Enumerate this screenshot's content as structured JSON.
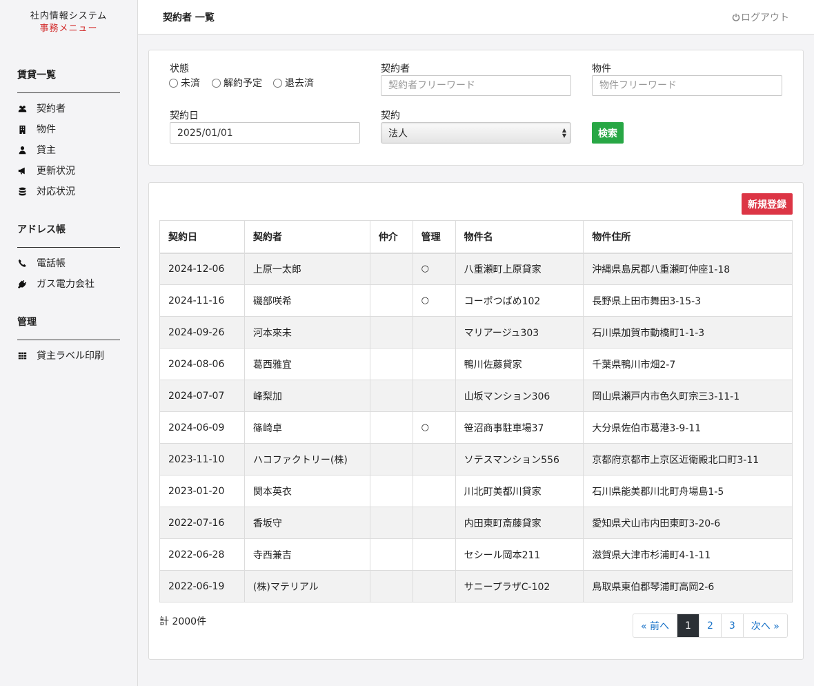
{
  "sidebar": {
    "brand_line1": "社内情報システム",
    "brand_line2": "事務メニュー",
    "sections": [
      {
        "title": "賃貸一覧",
        "items": [
          {
            "label": "契約者",
            "icon": "users-icon"
          },
          {
            "label": "物件",
            "icon": "building-icon"
          },
          {
            "label": "貸主",
            "icon": "user-icon"
          },
          {
            "label": "更新状況",
            "icon": "megaphone-icon"
          },
          {
            "label": "対応状況",
            "icon": "database-icon"
          }
        ]
      },
      {
        "title": "アドレス帳",
        "items": [
          {
            "label": "電話帳",
            "icon": "phone-icon"
          },
          {
            "label": "ガス電力会社",
            "icon": "plug-icon"
          }
        ]
      },
      {
        "title": "管理",
        "items": [
          {
            "label": "貸主ラベル印刷",
            "icon": "grid-icon"
          }
        ]
      }
    ]
  },
  "header": {
    "title": "契約者 一覧",
    "logout": "ログアウト"
  },
  "search": {
    "status_label": "状態",
    "status_options": [
      "未済",
      "解約予定",
      "退去済"
    ],
    "contractor_label": "契約者",
    "contractor_placeholder": "契約者フリーワード",
    "property_label": "物件",
    "property_placeholder": "物件フリーワード",
    "date_label": "契約日",
    "date_value": "2025/01/01",
    "contract_label": "契約",
    "contract_value": "法人",
    "search_button": "検索"
  },
  "list": {
    "new_button": "新規登録",
    "columns": [
      "契約日",
      "契約者",
      "仲介",
      "管理",
      "物件名",
      "物件住所"
    ],
    "rows": [
      [
        "2024-12-06",
        "上原一太郎",
        "",
        "○",
        "八重瀬町上原貸家",
        "沖縄県島尻郡八重瀬町仲座1-18"
      ],
      [
        "2024-11-16",
        "磯部咲希",
        "",
        "○",
        "コーポつばめ102",
        "長野県上田市舞田3-15-3"
      ],
      [
        "2024-09-26",
        "河本來未",
        "",
        "",
        "マリアージュ303",
        "石川県加賀市動橋町1-1-3"
      ],
      [
        "2024-08-06",
        "葛西雅宜",
        "",
        "",
        "鴨川佐藤貸家",
        "千葉県鴨川市畑2-7"
      ],
      [
        "2024-07-07",
        "峰梨加",
        "",
        "",
        "山坂マンション306",
        "岡山県瀬戸内市色久町宗三3-11-1"
      ],
      [
        "2024-06-09",
        "篠崎卓",
        "",
        "○",
        "笹沼商事駐車場37",
        "大分県佐伯市葛港3-9-11"
      ],
      [
        "2023-11-10",
        "ハコファクトリー(株)",
        "",
        "",
        "ソテスマンション556",
        "京都府京都市上京区近衛殿北口町3-11"
      ],
      [
        "2023-01-20",
        "関本英衣",
        "",
        "",
        "川北町美都川貸家",
        "石川県能美郡川北町舟場島1-5"
      ],
      [
        "2022-07-16",
        "香坂守",
        "",
        "",
        "内田東町斎藤貸家",
        "愛知県犬山市内田東町3-20-6"
      ],
      [
        "2022-06-28",
        "寺西兼吉",
        "",
        "",
        "セシール岡本211",
        "滋賀県大津市杉浦町4-1-11"
      ],
      [
        "2022-06-19",
        "(株)マテリアル",
        "",
        "",
        "サニープラザC-102",
        "鳥取県東伯郡琴浦町高岡2-6"
      ]
    ],
    "total": "計 2000件",
    "pagination": {
      "prev": "« 前へ",
      "pages": [
        "1",
        "2",
        "3"
      ],
      "current": "1",
      "next": "次へ »"
    }
  }
}
